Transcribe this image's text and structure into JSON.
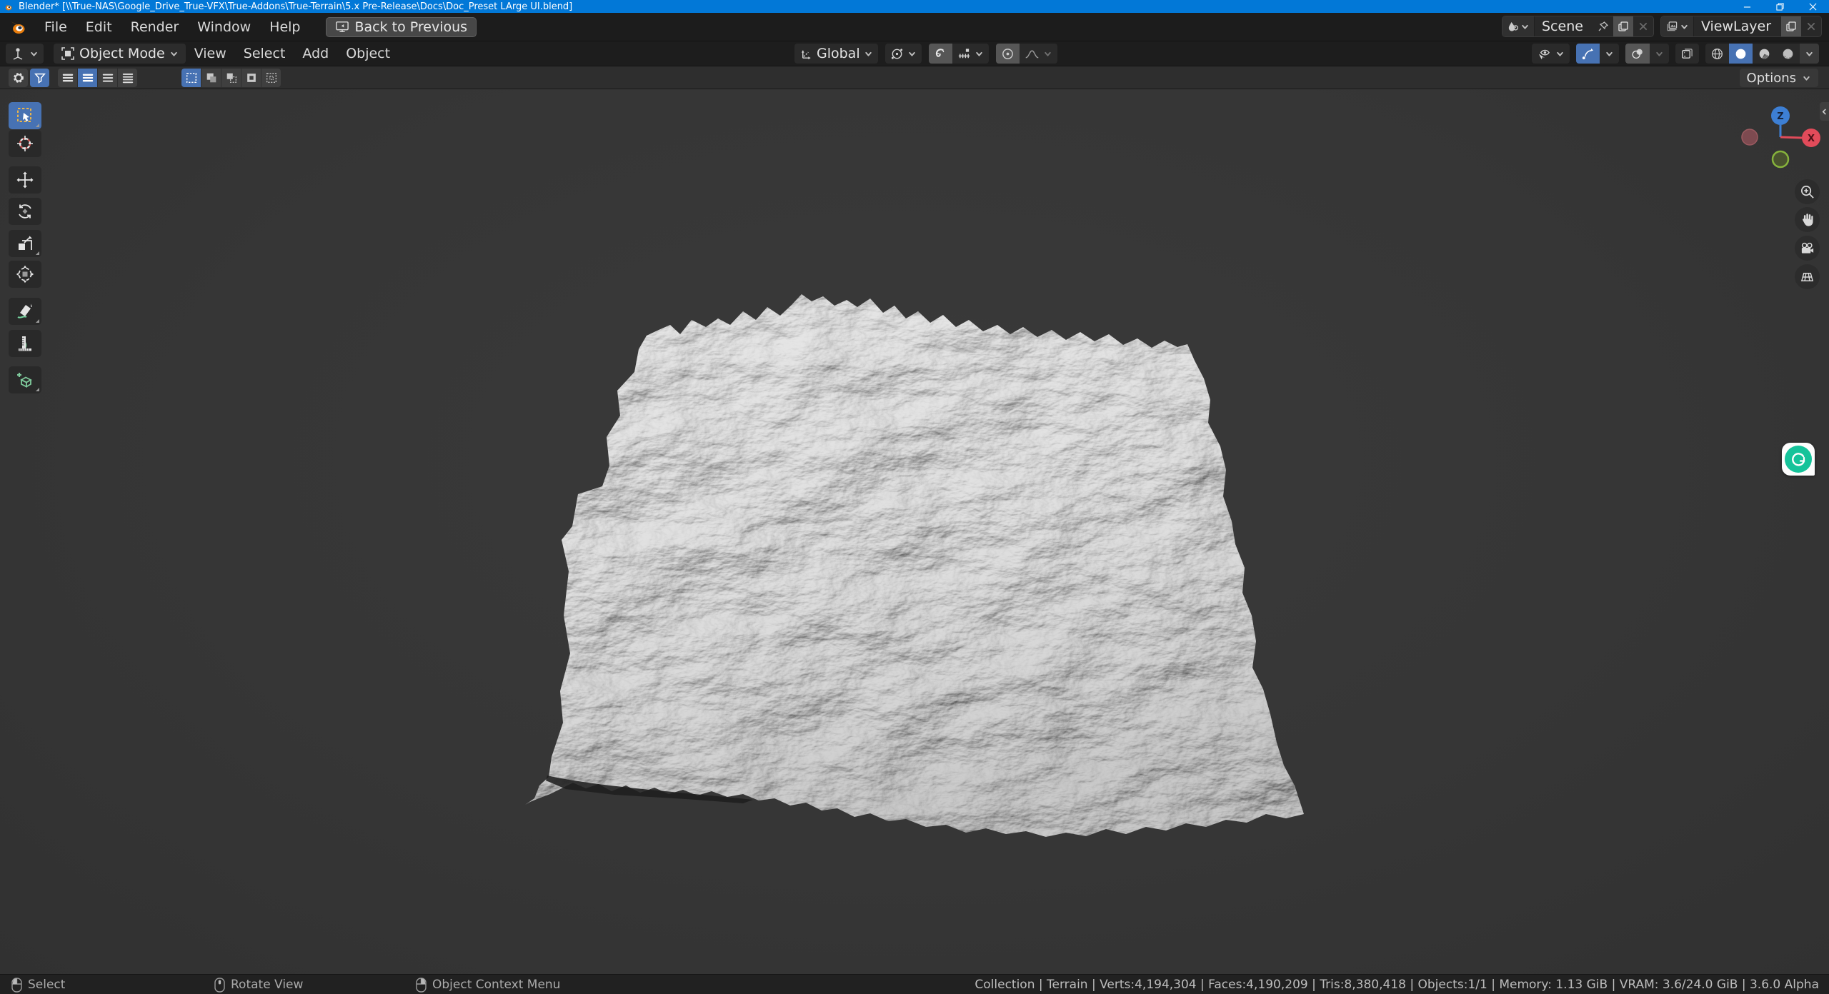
{
  "window": {
    "title": "Blender* [\\\\True-NAS\\Google_Drive_True-VFX\\True-Addons\\True-Terrain\\5.x Pre-Release\\Docs\\Doc_Preset LArge UI.blend]"
  },
  "menubar": {
    "items": [
      "File",
      "Edit",
      "Render",
      "Window",
      "Help"
    ],
    "back_button": "Back to Previous"
  },
  "topbar": {
    "scene": "Scene",
    "view_layer": "ViewLayer"
  },
  "viewport_header": {
    "mode": "Object Mode",
    "menus": [
      "View",
      "Select",
      "Add",
      "Object"
    ],
    "orientation": "Global"
  },
  "tool_header": {
    "options": "Options"
  },
  "axis_gizmo": {
    "z": "Z",
    "x": "X"
  },
  "statusbar": {
    "hints": [
      "Select",
      "Rotate View",
      "Object Context Menu"
    ],
    "stats": "Collection | Terrain | Verts:4,194,304 | Faces:4,190,209 | Tris:8,380,418 | Objects:1/1 | Memory: 1.13 GiB | VRAM: 3.6/24.0 GiB | 3.6.0 Alpha"
  },
  "icons": [
    "blender-logo",
    "back-monitor-icon",
    "scene-icon",
    "pin-icon",
    "duplicate-icon",
    "close-icon",
    "view-layer-icon",
    "editor-type-icon",
    "object-mode-icon",
    "chevron-down-icon",
    "orientation-axes-icon",
    "pivot-point-icon",
    "snap-magnet-icon",
    "snap-increment-icon",
    "proportional-edit-icon",
    "falloff-curve-icon",
    "visibility-icon",
    "gizmo-icon",
    "overlays-icon",
    "xray-icon",
    "shading-wireframe-icon",
    "shading-solid-icon",
    "shading-material-icon",
    "shading-rendered-icon",
    "gear-icon",
    "filter-icon",
    "list-rows-icon",
    "select-set-icon",
    "select-extend-icon",
    "select-subtract-icon",
    "select-invert-icon",
    "select-intersect-icon",
    "select-box-tool-icon",
    "cursor-tool-icon",
    "move-tool-icon",
    "rotate-tool-icon",
    "scale-tool-icon",
    "transform-tool-icon",
    "annotate-tool-icon",
    "measure-tool-icon",
    "add-cube-tool-icon",
    "zoom-icon",
    "pan-hand-icon",
    "camera-icon",
    "ortho-grid-icon",
    "mouse-left-icon",
    "mouse-middle-icon",
    "mouse-right-icon",
    "grammarly-icon"
  ],
  "colors": {
    "accent_blue": "#4772b3",
    "titlebar_blue": "#0278d7",
    "viewport_bg": "#363636",
    "gizmo_z": "#3d7fd4",
    "gizmo_x": "#e24b5a",
    "gizmo_y": "#86b33c",
    "grammarly_teal": "#15c39a",
    "blender_orange": "#e87d0d"
  }
}
